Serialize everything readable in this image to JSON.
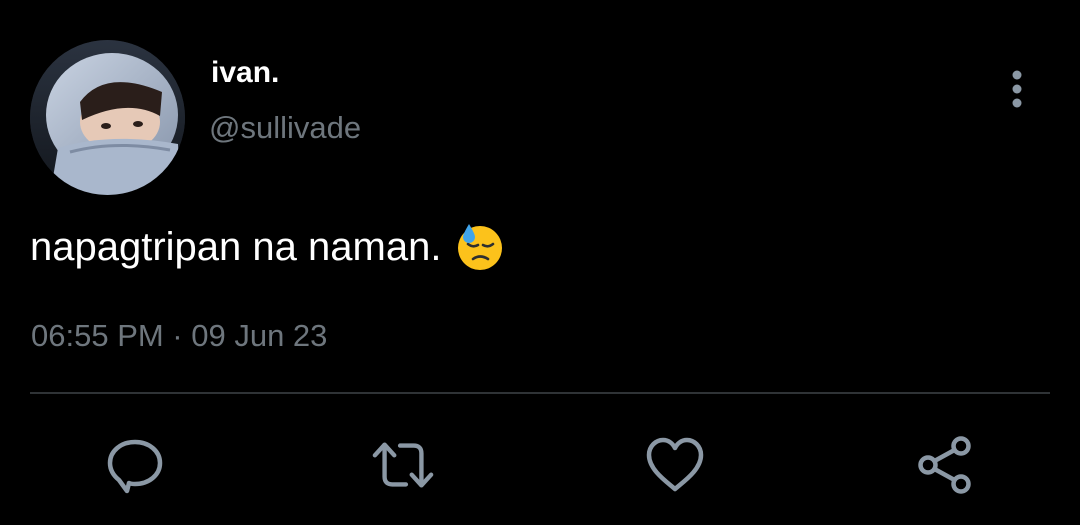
{
  "author": {
    "display_name": "ivan.",
    "handle": "@sullivade",
    "avatar_icon": "profile-photo"
  },
  "tweet": {
    "text": "napagtripan na naman.",
    "emoji": "downcast-face-with-sweat",
    "timestamp": "06:55 PM · 09 Jun 23"
  },
  "actions": {
    "reply_icon": "reply-icon",
    "retweet_icon": "retweet-icon",
    "like_icon": "heart-icon",
    "share_icon": "share-icon",
    "more_icon": "vertical-ellipsis-icon"
  },
  "colors": {
    "background": "#000000",
    "primary_text": "#ffffff",
    "secondary_text": "#6e767d",
    "divider": "#2f3336",
    "icon": "#8b98a5"
  }
}
